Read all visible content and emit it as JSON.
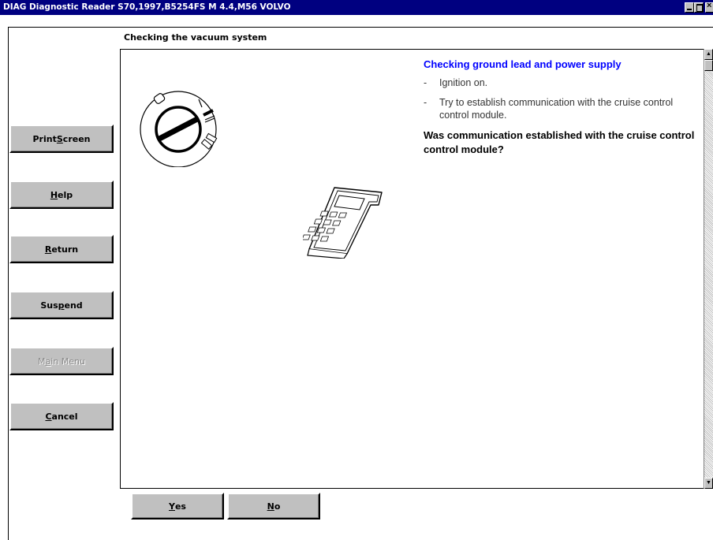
{
  "window": {
    "title": "DIAG Diagnostic Reader S70,1997,B5254FS M 4.4,M56 VOLVO"
  },
  "header": {
    "title": "Checking the vacuum system"
  },
  "sidebar": {
    "buttons": [
      {
        "pre": "Print ",
        "key": "S",
        "post": "creen",
        "enabled": true
      },
      {
        "pre": "",
        "key": "H",
        "post": "elp",
        "enabled": true
      },
      {
        "pre": "",
        "key": "R",
        "post": "eturn",
        "enabled": true
      },
      {
        "pre": "Sus",
        "key": "p",
        "post": "end",
        "enabled": true
      },
      {
        "pre": "M",
        "key": "a",
        "post": "in Menu",
        "enabled": false
      },
      {
        "pre": "",
        "key": "C",
        "post": "ancel",
        "enabled": true
      }
    ]
  },
  "instructions": {
    "heading": "Checking ground lead and power supply",
    "steps": [
      {
        "dash": "-",
        "text": "Ignition on."
      },
      {
        "dash": "-",
        "text": "Try to establish communication with the cruise control control module."
      }
    ],
    "question": "Was communication established with the cruise control control module?"
  },
  "answers": {
    "yes": {
      "pre": "",
      "key": "Y",
      "post": "es"
    },
    "no": {
      "pre": "",
      "key": "N",
      "post": "o"
    }
  },
  "illustrations": {
    "ignition": "ignition-switch-icon",
    "reader": "diagnostic-reader-icon"
  },
  "colors": {
    "titlebar": "#000080",
    "heading": "#0000ff",
    "button_face": "#c0c0c0"
  }
}
